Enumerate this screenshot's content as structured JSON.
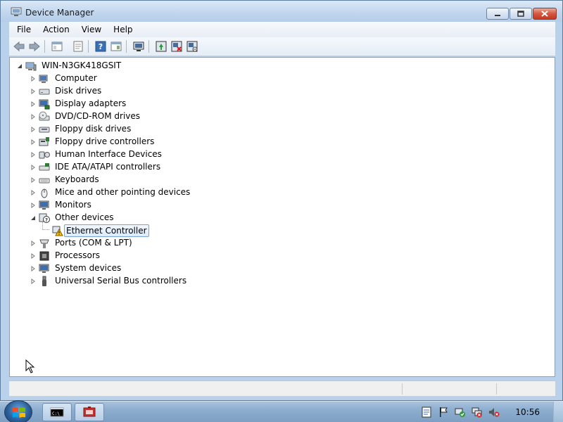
{
  "window": {
    "title": "Device Manager",
    "icon": "device-manager-icon"
  },
  "menu": {
    "file": "File",
    "action": "Action",
    "view": "View",
    "help": "Help"
  },
  "toolbar": {
    "buttons": [
      "back-icon",
      "forward-icon",
      "show-hide-console-tree-icon",
      "properties-icon",
      "help-icon",
      "show-hide-action-pane-icon",
      "scan-hardware-icon",
      "update-driver-icon",
      "uninstall-icon",
      "disable-icon"
    ]
  },
  "tree": {
    "root": "WIN-N3GK418GSIT",
    "categories": [
      {
        "label": "Computer",
        "icon": "computer-icon"
      },
      {
        "label": "Disk drives",
        "icon": "disk-drive-icon"
      },
      {
        "label": "Display adapters",
        "icon": "display-adapter-icon"
      },
      {
        "label": "DVD/CD-ROM drives",
        "icon": "dvd-drive-icon"
      },
      {
        "label": "Floppy disk drives",
        "icon": "floppy-drive-icon"
      },
      {
        "label": "Floppy drive controllers",
        "icon": "floppy-controller-icon"
      },
      {
        "label": "Human Interface Devices",
        "icon": "hid-icon"
      },
      {
        "label": "IDE ATA/ATAPI controllers",
        "icon": "ide-controller-icon"
      },
      {
        "label": "Keyboards",
        "icon": "keyboard-icon"
      },
      {
        "label": "Mice and other pointing devices",
        "icon": "mouse-icon"
      },
      {
        "label": "Monitors",
        "icon": "monitor-icon"
      },
      {
        "label": "Other devices",
        "icon": "unknown-device-icon"
      },
      {
        "label": "Ports (COM & LPT)",
        "icon": "port-icon"
      },
      {
        "label": "Processors",
        "icon": "processor-icon"
      },
      {
        "label": "System devices",
        "icon": "system-device-icon"
      },
      {
        "label": "Universal Serial Bus controllers",
        "icon": "usb-icon"
      }
    ],
    "other_devices_child": "Ethernet Controller"
  },
  "taskbar": {
    "clock": "10:56",
    "tasks": [
      "command-prompt-icon",
      "device-manager-icon"
    ],
    "tray": [
      "notes-icon",
      "flag-icon",
      "network-check-icon",
      "network-error-icon",
      "volume-muted-icon"
    ]
  }
}
